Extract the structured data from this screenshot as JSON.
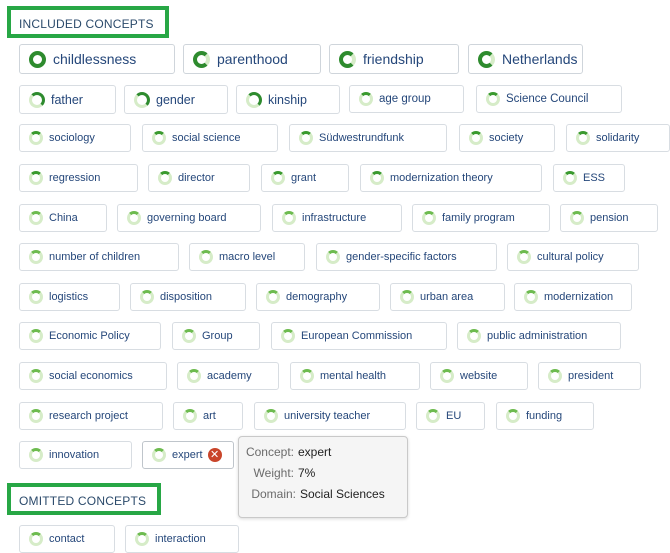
{
  "included_header": "INCLUDED CONCEPTS",
  "omitted_header": "OMITTED CONCEPTS",
  "concepts": {
    "childlessness": "childlessness",
    "parenthood": "parenthood",
    "friendship": "friendship",
    "netherlands": "Netherlands",
    "father": "father",
    "gender": "gender",
    "kinship": "kinship",
    "age_group": "age group",
    "science_council": "Science Council",
    "sociology": "sociology",
    "social_science": "social science",
    "sudwestrundfunk": "Südwestrundfunk",
    "society": "society",
    "solidarity": "solidarity",
    "regression": "regression",
    "director": "director",
    "grant": "grant",
    "modernization_theory": "modernization theory",
    "ess": "ESS",
    "china": "China",
    "governing_board": "governing board",
    "infrastructure": "infrastructure",
    "family_program": "family program",
    "pension": "pension",
    "number_of_children": "number of children",
    "macro_level": "macro level",
    "gender_specific_factors": "gender-specific factors",
    "cultural_policy": "cultural policy",
    "logistics": "logistics",
    "disposition": "disposition",
    "demography": "demography",
    "urban_area": "urban area",
    "modernization": "modernization",
    "economic_policy": "Economic Policy",
    "group": "Group",
    "european_commission": "European Commission",
    "public_administration": "public administration",
    "social_economics": "social economics",
    "academy": "academy",
    "mental_health": "mental health",
    "website": "website",
    "president": "president",
    "research_project": "research project",
    "art": "art",
    "university_teacher": "university teacher",
    "eu": "EU",
    "funding": "funding",
    "innovation": "innovation",
    "expert": "expert",
    "contact": "contact",
    "interaction": "interaction"
  },
  "remove_glyph": "✕",
  "tooltip": {
    "concept_label": "Concept:",
    "concept_value": "expert",
    "weight_label": "Weight:",
    "weight_value": "7%",
    "domain_label": "Domain:",
    "domain_value": "Social Sciences"
  },
  "colors": {
    "highlight_border": "#27a745",
    "ring_fill": "#2e8b2e",
    "ring_track": "#d6ecc8",
    "chip_text": "#25477a",
    "remove_icon": "#c9452a"
  },
  "icons": {
    "weight_indicator": "weight-ring-icon",
    "remove": "remove-circle-icon"
  }
}
